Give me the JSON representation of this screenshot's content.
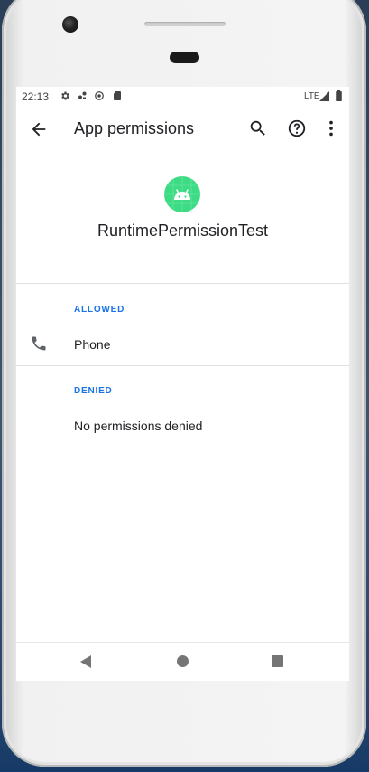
{
  "status_bar": {
    "time": "22:13",
    "network": "LTE",
    "icons": [
      "settings-icon",
      "bug-icon",
      "sync-icon",
      "sd-card-icon",
      "signal-icon",
      "battery-icon"
    ]
  },
  "app_bar": {
    "title": "App permissions",
    "icons": [
      "back-arrow-icon",
      "search-icon",
      "help-icon",
      "more-vert-icon"
    ]
  },
  "app": {
    "name": "RuntimePermissionTest",
    "icon": "android-icon",
    "icon_color": "#3ddc84"
  },
  "sections": {
    "allowed": {
      "label": "ALLOWED",
      "items": [
        {
          "label": "Phone",
          "icon": "phone-icon"
        }
      ]
    },
    "denied": {
      "label": "DENIED",
      "empty_text": "No permissions denied"
    }
  },
  "nav_bar": {
    "icons": [
      "nav-back-icon",
      "nav-home-icon",
      "nav-recents-icon"
    ]
  },
  "colors": {
    "accent": "#1a73e8",
    "text": "#202124",
    "divider": "#e0e0e0"
  }
}
